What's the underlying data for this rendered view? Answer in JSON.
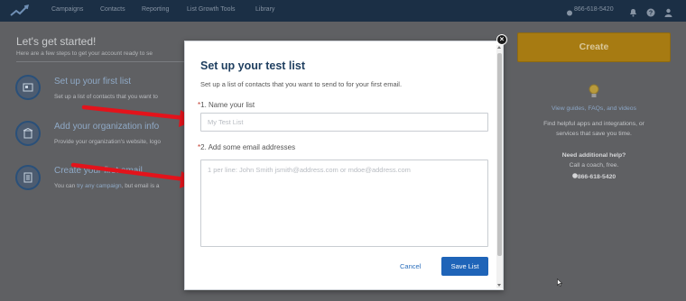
{
  "nav": {
    "items": [
      "Campaigns",
      "Contacts",
      "Reporting",
      "List Growth Tools",
      "Library"
    ],
    "phone": "866-618-5420"
  },
  "background": {
    "title": "Let's get started!",
    "subtitle": "Here are a few steps to get your account ready to se",
    "steps": [
      {
        "title": "Set up your first list",
        "desc": "Set up a list of contacts that you want to",
        "icon": "contact-card-icon"
      },
      {
        "title": "Add your organization info",
        "desc": "Provide your organization's website, logo",
        "icon": "building-icon"
      },
      {
        "title": "Create your first email",
        "desc_prefix": "You can",
        "desc_link": "try any campaign",
        "desc_suffix": ", but email is a",
        "icon": "email-document-icon"
      }
    ],
    "sidebar": {
      "create_label": "Create",
      "guides": "View guides, FAQs, and videos",
      "apps_line1": "Find helpful apps and integrations, or",
      "apps_line2": "services that save you time.",
      "help_title": "Need additional help?",
      "help_sub": "Call a coach, free.",
      "help_phone": "866-618-5420"
    }
  },
  "modal": {
    "title": "Set up your test list",
    "description": "Set up a list of contacts that you want to send to for your first email.",
    "field1_num": "1. Name your list",
    "field1_placeholder": "My Test List",
    "field2_num": "2. Add some email addresses",
    "field2_placeholder": "1 per line: John Smith jsmith@address.com or mdoe@address.com",
    "required_mark": "*",
    "cancel_label": "Cancel",
    "save_label": "Save List",
    "close_label": "×"
  },
  "colors": {
    "accent": "#1f64b8",
    "nav_bg": "#1b2f45",
    "create_btn": "#a77b12",
    "arrow": "#e3131b"
  }
}
